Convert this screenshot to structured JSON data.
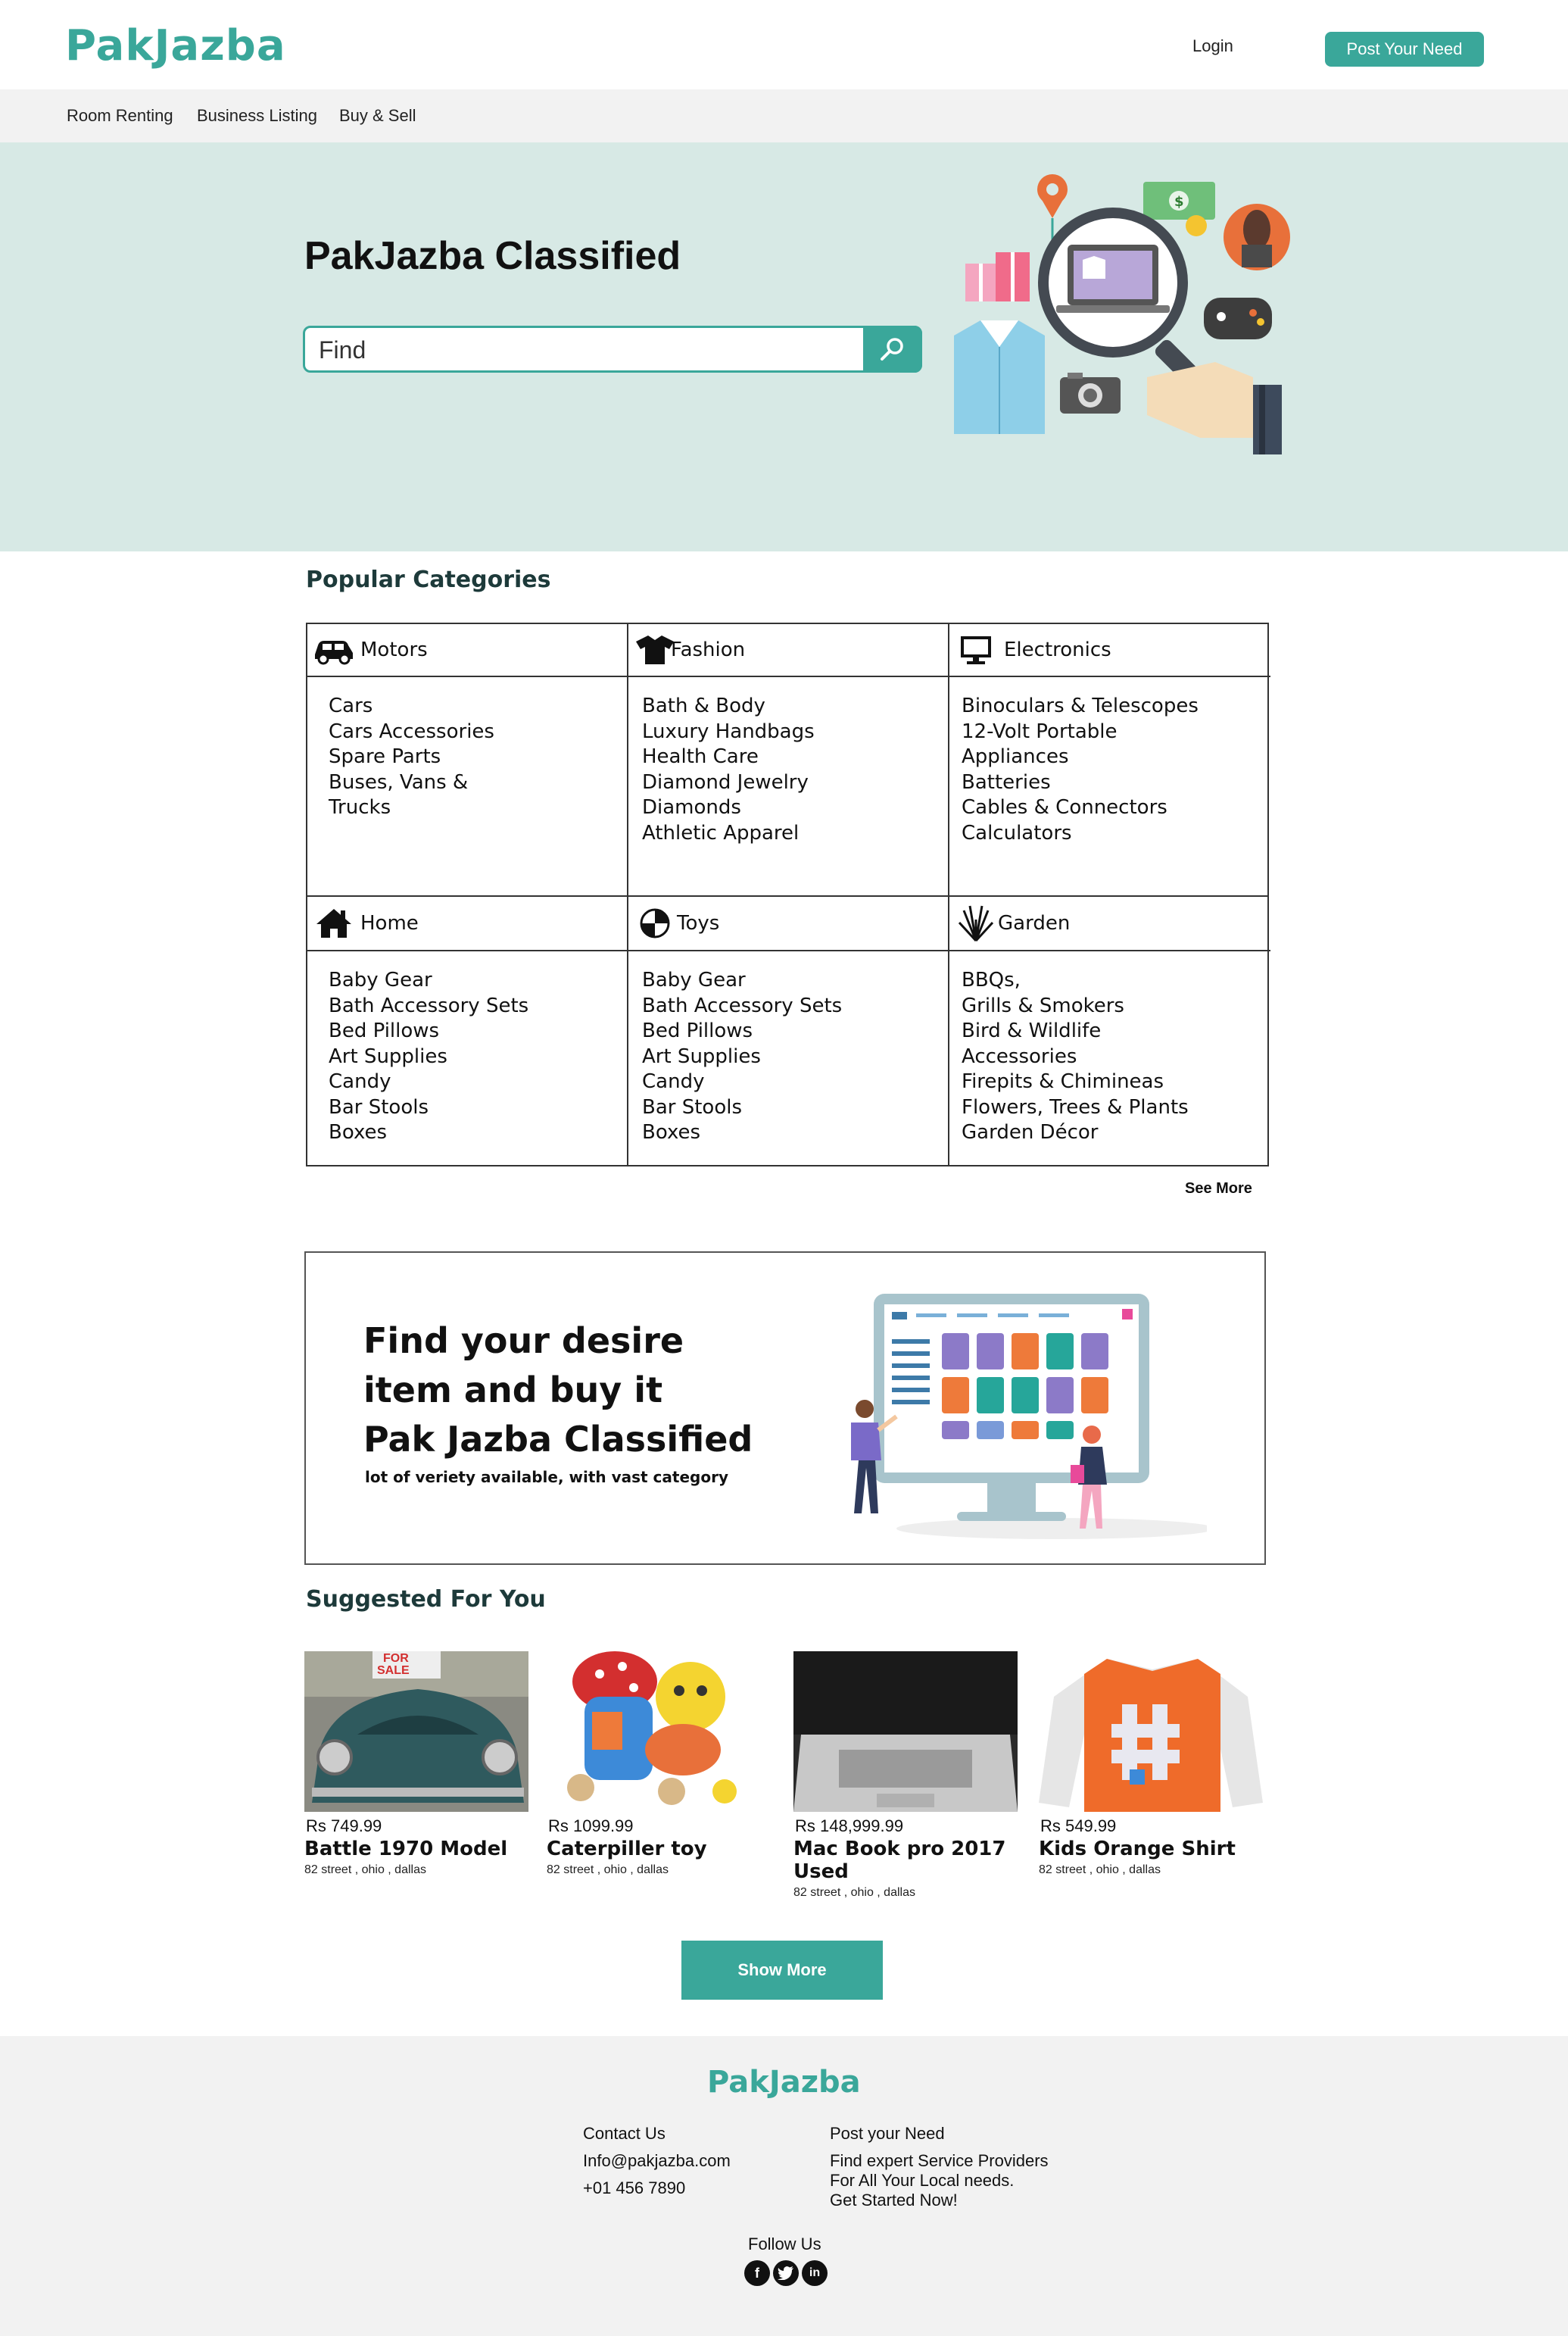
{
  "header": {
    "logo": "PakJazba",
    "login": "Login",
    "post_need": "Post Your Need"
  },
  "subnav": [
    "Room Renting",
    "Business Listing",
    "Buy & Sell"
  ],
  "hero": {
    "title": "PakJazba Classified",
    "search_value": "Find"
  },
  "popular": {
    "title": "Popular Categories",
    "categories": [
      {
        "name": "Motors",
        "icon": "car-icon",
        "items": [
          "Cars",
          "Cars Accessories",
          "Spare Parts",
          "Buses, Vans &",
          "Trucks"
        ]
      },
      {
        "name": "Fashion",
        "icon": "shirt-icon",
        "items": [
          "Bath & Body",
          "Luxury Handbags",
          "Health Care",
          "Diamond Jewelry",
          "Diamonds",
          "Athletic Apparel"
        ]
      },
      {
        "name": "Electronics",
        "icon": "monitor-icon",
        "items": [
          "Binoculars & Telescopes",
          "12-Volt Portable",
          "Appliances",
          "Batteries",
          "Cables & Connectors",
          "Calculators"
        ]
      },
      {
        "name": "Home",
        "icon": "house-icon",
        "items": [
          "Baby Gear",
          "Bath Accessory Sets",
          "Bed Pillows",
          "Art Supplies",
          "Candy",
          "Bar Stools",
          "Boxes"
        ]
      },
      {
        "name": "Toys",
        "icon": "ball-icon",
        "items": [
          "Baby Gear",
          "Bath Accessory Sets",
          "Bed Pillows",
          "Art Supplies",
          "Candy",
          "Bar Stools",
          "Boxes"
        ]
      },
      {
        "name": "Garden",
        "icon": "plant-icon",
        "items": [
          "BBQs,",
          "Grills & Smokers",
          "Bird & Wildlife",
          "Accessories",
          "Firepits & Chimineas",
          "Flowers, Trees & Plants",
          "Garden Décor"
        ]
      }
    ],
    "see_more": "See More"
  },
  "banner": {
    "line1": "Find your desire",
    "line2": "item and buy it",
    "line3": "Pak Jazba Classified",
    "sub": "lot of veriety available, with vast category"
  },
  "suggested": {
    "title": "Suggested For You",
    "items": [
      {
        "price": "Rs 749.99",
        "name": "Battle 1970 Model",
        "address": "82 street , ohio , dallas"
      },
      {
        "price": "Rs 1099.99",
        "name": "Caterpiller toy",
        "address": "82 street , ohio , dallas"
      },
      {
        "price": "Rs 148,999.99",
        "name": "Mac Book pro 2017 Used",
        "address": "82 street , ohio , dallas"
      },
      {
        "price": "Rs 549.99",
        "name": "Kids Orange Shirt",
        "address": "82 street , ohio , dallas"
      }
    ],
    "show_more": "Show More"
  },
  "footer": {
    "logo": "PakJazba",
    "contact_title": "Contact Us",
    "email": "Info@pakjazba.com",
    "phone": "+01  456 7890",
    "post_title": "Post your Need",
    "post_line1": "Find expert Service Providers",
    "post_line2": "For All Your Local needs.",
    "post_line3": "Get Started Now!",
    "follow": "Follow Us"
  },
  "colors": {
    "accent": "#3aa79a",
    "hero_bg": "#d7e9e5",
    "footer_bg": "#f2f2f2"
  }
}
